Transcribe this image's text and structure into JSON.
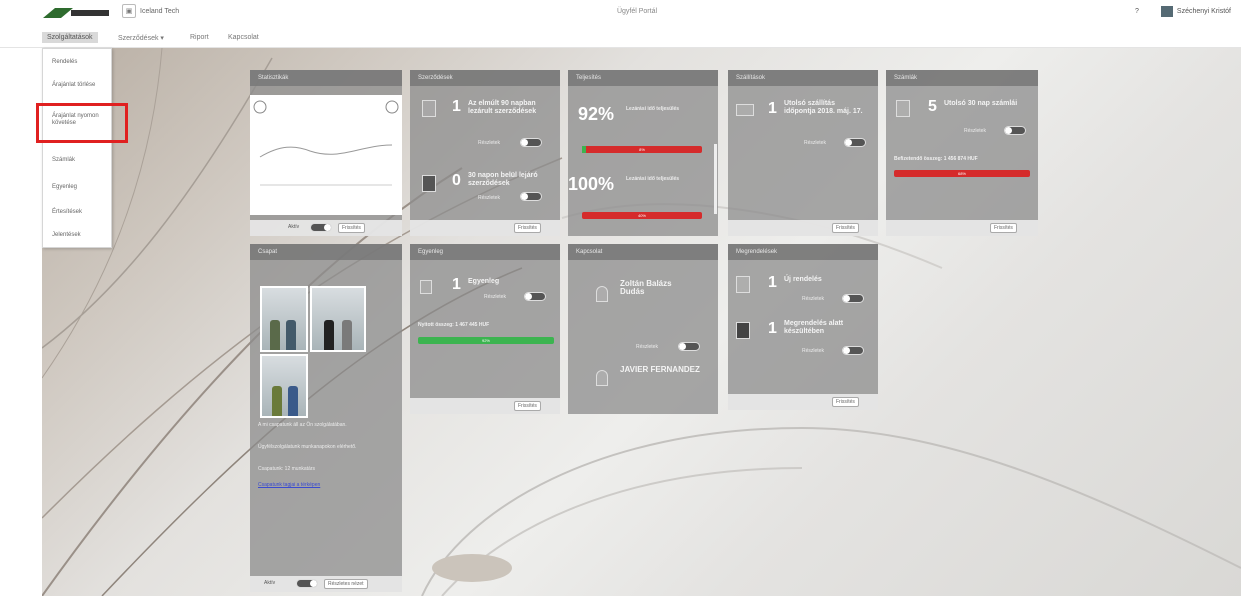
{
  "topbar": {
    "company_name": "Iceland Tech",
    "center_title": "Ügyfél Portál",
    "help": "?",
    "user_name": "Széchenyi Kristóf"
  },
  "nav": {
    "items": [
      {
        "label": "Szolgáltatások"
      },
      {
        "label": "Szerződések ▾"
      },
      {
        "label": "Riport"
      },
      {
        "label": "Kapcsolat"
      }
    ]
  },
  "dropdown": {
    "items": [
      {
        "label": "Rendelés"
      },
      {
        "label": "Árajánlat törlése"
      },
      {
        "label": "Árajánlat nyomon követése"
      },
      {
        "label": "Számlák"
      },
      {
        "label": "Egyenleg"
      },
      {
        "label": "Értesítések"
      },
      {
        "label": "Jelentések"
      }
    ]
  },
  "widgets": {
    "stats": {
      "title": "Statisztikák",
      "footer_label": "Aktív",
      "refresh": "Frissítés"
    },
    "contracts": {
      "title": "Szerződések",
      "n1": "1",
      "t1": "Az elmúlt 90 napban lezárult szerződések",
      "n2": "0",
      "t2": "30 napon belül lejáró szerződések",
      "details": "Részletek",
      "refresh": "Frissítés"
    },
    "sla": {
      "title": "Teljesítés",
      "p1": "92%",
      "t1": "Lezárási idő teljesülés",
      "p2": "100%",
      "t2": "Lezárási idő teljesülés",
      "bar1": "8%",
      "bar2": "40%"
    },
    "delivery": {
      "title": "Szállítások",
      "n1": "1",
      "t1": "Utolsó szállítás időpontja 2018. máj. 17.",
      "details": "Részletek",
      "refresh": "Frissítés"
    },
    "invoices": {
      "title": "Számlák",
      "n1": "5",
      "t1": "Utolsó 30 nap számlái",
      "details": "Részletek",
      "balance_label": "Befizetendő összeg: 1 456 874 HUF",
      "bar": "68%",
      "refresh": "Frissítés"
    },
    "team": {
      "title": "Csapat",
      "desc1": "A mi csapatunk áll az Ön szolgálatában.",
      "desc2": "Ügyfélszolgálatunk munkanapokon elérhető.",
      "desc3": "Csapatunk: 12 munkatárs",
      "link": "Csapatunk tagjai a térképen",
      "footer_label": "Aktív",
      "footer_btn": "Részletes nézet"
    },
    "balance": {
      "title": "Egyenleg",
      "n1": "1",
      "t1": "Egyenleg",
      "details": "Részletek",
      "amount_label": "Nyitott összeg: 1 467 445 HUF",
      "bar": "92%",
      "refresh": "Frissítés"
    },
    "contacts": {
      "title": "Kapcsolat",
      "name1": "Zoltán Balázs Dudás",
      "name2": "JAVIER FERNANDEZ",
      "details": "Részletek"
    },
    "orders": {
      "title": "Megrendelések",
      "n1": "1",
      "t1": "Új rendelés",
      "n2": "1",
      "t2": "Megrendelés alatt készültében",
      "details": "Részletek",
      "refresh": "Frissítés"
    }
  }
}
